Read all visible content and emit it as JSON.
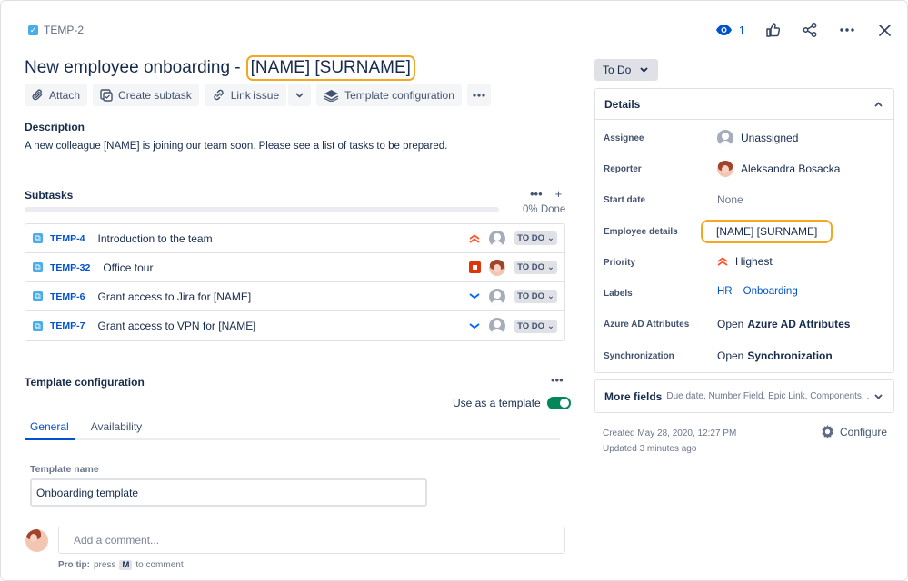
{
  "issue": {
    "key": "TEMP-2",
    "title_prefix": "New employee onboarding -",
    "title_highlight": "[NAME] [SURNAME]"
  },
  "top_actions": {
    "watch_count": "1"
  },
  "toolbar": {
    "attach": "Attach",
    "create_subtask": "Create subtask",
    "link_issue": "Link issue",
    "template_configuration": "Template configuration"
  },
  "description": {
    "heading": "Description",
    "text": "A new colleague [NAME] is joining our team soon. Please see a list of tasks to be prepared."
  },
  "subtasks": {
    "heading": "Subtasks",
    "progress_percent": 0,
    "progress_label": "0% Done",
    "items": [
      {
        "key": "TEMP-4",
        "summary": "Introduction to the team",
        "priority": "highest",
        "assignee": "unassigned",
        "status": "TO DO"
      },
      {
        "key": "TEMP-32",
        "summary": "Office tour",
        "priority": "blocker",
        "assignee": "user",
        "status": "TO DO"
      },
      {
        "key": "TEMP-6",
        "summary": "Grant access to Jira for [NAME]",
        "priority": "lowest",
        "assignee": "unassigned",
        "status": "TO DO"
      },
      {
        "key": "TEMP-7",
        "summary": "Grant access to VPN for [NAME]",
        "priority": "lowest",
        "assignee": "unassigned",
        "status": "TO DO"
      }
    ]
  },
  "template_config": {
    "heading": "Template configuration",
    "use_as_template_label": "Use as a template",
    "use_as_template": true,
    "tabs": [
      "General",
      "Availability"
    ],
    "active_tab": "General",
    "template_name_label": "Template name",
    "template_name_value": "Onboarding template"
  },
  "comment": {
    "placeholder": "Add a comment...",
    "protip_prefix": "Pro tip:",
    "protip_press": "press",
    "protip_key": "M",
    "protip_suffix": "to comment"
  },
  "status_button": "To Do",
  "details": {
    "heading": "Details",
    "fields": {
      "assignee_label": "Assignee",
      "assignee_value": "Unassigned",
      "reporter_label": "Reporter",
      "reporter_value": "Aleksandra Bosacka",
      "start_date_label": "Start date",
      "start_date_value": "None",
      "employee_details_label": "Employee details",
      "employee_details_value": "[NAME] [SURNAME]",
      "priority_label": "Priority",
      "priority_value": "Highest",
      "labels_label": "Labels",
      "labels_values": [
        "HR",
        "Onboarding"
      ],
      "azure_label": "Azure AD Attributes",
      "azure_prefix": "Open",
      "azure_value": "Azure AD Attributes",
      "sync_label": "Synchronization",
      "sync_prefix": "Open",
      "sync_value": "Synchronization"
    }
  },
  "more_fields": {
    "title": "More fields",
    "subtitle": "Due date, Number Field, Epic Link, Components, ..."
  },
  "meta": {
    "created": "Created May 28, 2020, 12:27 PM",
    "updated": "Updated 3 minutes ago",
    "configure": "Configure"
  },
  "colors": {
    "link": "#0052CC",
    "highlight": "#F5A623",
    "priority_high": "#FF5630",
    "priority_low": "#0065FF",
    "toggle_on": "#00875A"
  }
}
